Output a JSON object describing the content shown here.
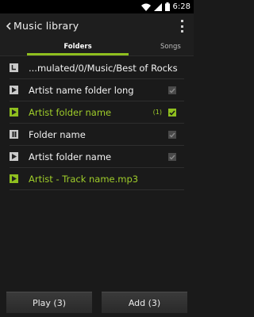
{
  "status": {
    "time": "6:28"
  },
  "header": {
    "title": "Music library"
  },
  "tabs": [
    {
      "label": "Folders"
    },
    {
      "label": "Songs"
    }
  ],
  "rows": [
    {
      "label": "...mulated/0/Music/Best of Rocks",
      "icon": "parent-folder-icon",
      "checkbox": "none"
    },
    {
      "label": "Artist name folder long",
      "icon": "play-folder-icon",
      "checkbox": "unchecked"
    },
    {
      "label": "Artist folder name",
      "icon": "play-folder-icon",
      "checkbox": "checked",
      "count": "(1)",
      "highlighted": true
    },
    {
      "label": "Folder name",
      "icon": "pause-folder-icon",
      "checkbox": "unchecked"
    },
    {
      "label": "Artist folder name",
      "icon": "play-folder-icon",
      "checkbox": "unchecked"
    },
    {
      "label": "Artist - Track name.mp3",
      "icon": "play-track-icon",
      "checkbox": "none",
      "highlighted": true
    }
  ],
  "buttons": {
    "play": "Play (3)",
    "add": "Add (3)"
  },
  "colors": {
    "accent": "#8fbf1f",
    "background": "#1a1a1a"
  }
}
